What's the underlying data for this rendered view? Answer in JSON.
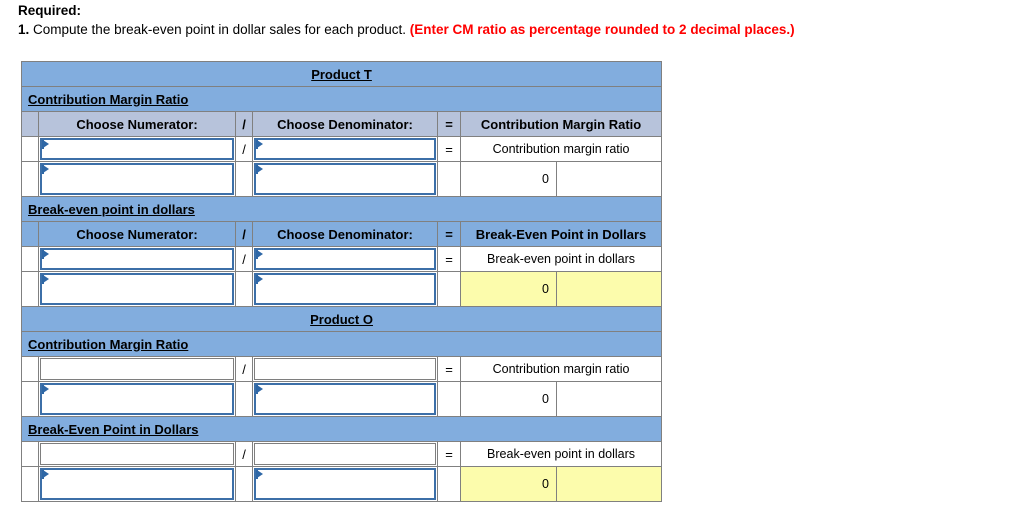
{
  "prompt": {
    "required_label": "Required:",
    "number": "1.",
    "question": "Compute the break-even point in dollar sales for each product.",
    "note": "(Enter CM ratio as percentage rounded to 2 decimal places.)",
    "note_color": "#ff0000"
  },
  "colors": {
    "band": "#82ADDE",
    "band_soft": "#B7C3DB",
    "highlight": "#FCFCAC",
    "dropdown_border": "#3C6FA8",
    "grid": "#808080"
  },
  "labels": {
    "choose_numerator": "Choose Numerator:",
    "choose_denominator": "Choose Denominator:",
    "slash": "/",
    "equals": "=",
    "cm_ratio_header": "Contribution Margin Ratio",
    "be_dollars_header": "Break-Even Point in Dollars",
    "cm_ratio_result": "Contribution margin ratio",
    "be_dollars_result": "Break-even point in dollars",
    "zero": "0"
  },
  "sections": [
    {
      "title": "Product T",
      "blocks": [
        {
          "heading": "Contribution Margin Ratio",
          "heading_style": "band",
          "has_column_header": true,
          "column_header_style": "band_soft",
          "result_column_header": "Contribution Margin Ratio",
          "rows": [
            {
              "numerator": "",
              "denominator": "",
              "slash": "/",
              "equals": "=",
              "result_label": "Contribution margin ratio",
              "type": "formula",
              "numerator_control": "dropdown",
              "denominator_control": "dropdown"
            },
            {
              "numerator": "",
              "denominator": "",
              "slash": "",
              "equals": "",
              "result_value": "0",
              "type": "value",
              "highlight": false,
              "numerator_control": "dropdown",
              "denominator_control": "dropdown"
            }
          ]
        },
        {
          "heading": "Break-even point in dollars",
          "heading_style": "band",
          "has_column_header": true,
          "column_header_style": "band",
          "result_column_header": "Break-Even Point in Dollars",
          "rows": [
            {
              "numerator": "",
              "denominator": "",
              "slash": "/",
              "equals": "=",
              "result_label": "Break-even point in dollars",
              "type": "formula",
              "numerator_control": "dropdown",
              "denominator_control": "dropdown"
            },
            {
              "numerator": "",
              "denominator": "",
              "slash": "",
              "equals": "",
              "result_value": "0",
              "type": "value",
              "highlight": true,
              "numerator_control": "dropdown",
              "denominator_control": "dropdown"
            }
          ]
        }
      ]
    },
    {
      "title": "Product O",
      "blocks": [
        {
          "heading": "Contribution Margin Ratio",
          "heading_style": "band",
          "has_column_header": false,
          "rows": [
            {
              "numerator": "",
              "denominator": "",
              "slash": "/",
              "equals": "=",
              "result_label": "Contribution margin ratio",
              "type": "formula",
              "numerator_control": "plain",
              "denominator_control": "plain"
            },
            {
              "numerator": "",
              "denominator": "",
              "slash": "",
              "equals": "",
              "result_value": "0",
              "type": "value",
              "highlight": false,
              "numerator_control": "dropdown",
              "denominator_control": "dropdown"
            }
          ]
        },
        {
          "heading": "Break-Even Point in Dollars",
          "heading_style": "band",
          "has_column_header": false,
          "rows": [
            {
              "numerator": "",
              "denominator": "",
              "slash": "/",
              "equals": "=",
              "result_label": "Break-even point in dollars",
              "type": "formula",
              "numerator_control": "plain",
              "denominator_control": "plain"
            },
            {
              "numerator": "",
              "denominator": "",
              "slash": "",
              "equals": "",
              "result_value": "0",
              "type": "value",
              "highlight": true,
              "numerator_control": "dropdown",
              "denominator_control": "dropdown"
            }
          ]
        }
      ]
    }
  ]
}
